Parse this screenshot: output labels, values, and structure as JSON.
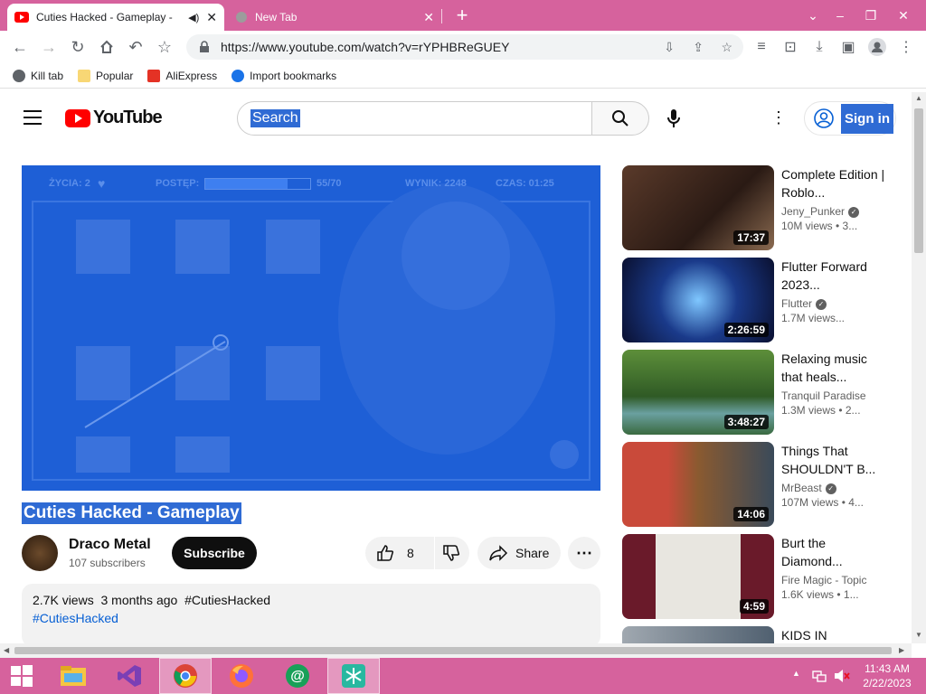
{
  "browser": {
    "tabs": [
      {
        "title": "Cuties Hacked - Gameplay -",
        "active": true
      },
      {
        "title": "New Tab",
        "active": false
      }
    ],
    "url": "https://www.youtube.com/watch?v=rYPHBReGUEY",
    "bookmarks": [
      {
        "label": "Kill tab",
        "icon": "globe-icon"
      },
      {
        "label": "Popular",
        "icon": "folder-icon"
      },
      {
        "label": "AliExpress",
        "icon": "aliexpress-icon"
      },
      {
        "label": "Import bookmarks",
        "icon": "gear-icon"
      }
    ]
  },
  "youtube": {
    "logo": "YouTube",
    "search_placeholder": "Search",
    "sign_in": "Sign in"
  },
  "player": {
    "hud_lives": "ŻYCIA: 2",
    "hud_progress_label": "POSTĘP:",
    "hud_progress_value": "55/70",
    "hud_progress_fraction": 0.786,
    "hud_score": "WYNIK: 2248",
    "hud_time": "CZAS: 01:25"
  },
  "video": {
    "title": "Cuties Hacked - Gameplay",
    "channel": "Draco Metal",
    "subscribers": "107 subscribers",
    "subscribe": "Subscribe",
    "likes": "8",
    "share": "Share",
    "views_date": "2.7K views  3 months ago  #CutiesHacked",
    "tag": "#CutiesHacked"
  },
  "recommendations": [
    {
      "title": "Complete Edition | Roblo...",
      "channel": "Jeny_Punker",
      "verified": true,
      "views": "10M views • 3...",
      "duration": "17:37"
    },
    {
      "title": "Flutter Forward 2023...",
      "channel": "Flutter",
      "verified": true,
      "views": "1.7M views...",
      "duration": "2:26:59"
    },
    {
      "title": "Relaxing music that heals...",
      "channel": "Tranquil Paradise",
      "verified": false,
      "views": "1.3M views • 2...",
      "duration": "3:48:27"
    },
    {
      "title": "Things That SHOULDN'T B...",
      "channel": "MrBeast",
      "verified": true,
      "views": "107M views • 4...",
      "duration": "14:06"
    },
    {
      "title": "Burt the Diamond...",
      "channel": "Fire Magic - Topic",
      "verified": false,
      "views": "1.6K views • 1...",
      "duration": "4:59"
    },
    {
      "title": "KIDS IN",
      "channel": "",
      "verified": false,
      "views": "",
      "duration": ""
    }
  ],
  "taskbar": {
    "time": "11:43 AM",
    "date": "2/22/2023"
  },
  "colors": {
    "chrome_accent": "#d6629d",
    "youtube_red": "#ff0000",
    "selection_blue": "#2f6bd4"
  }
}
